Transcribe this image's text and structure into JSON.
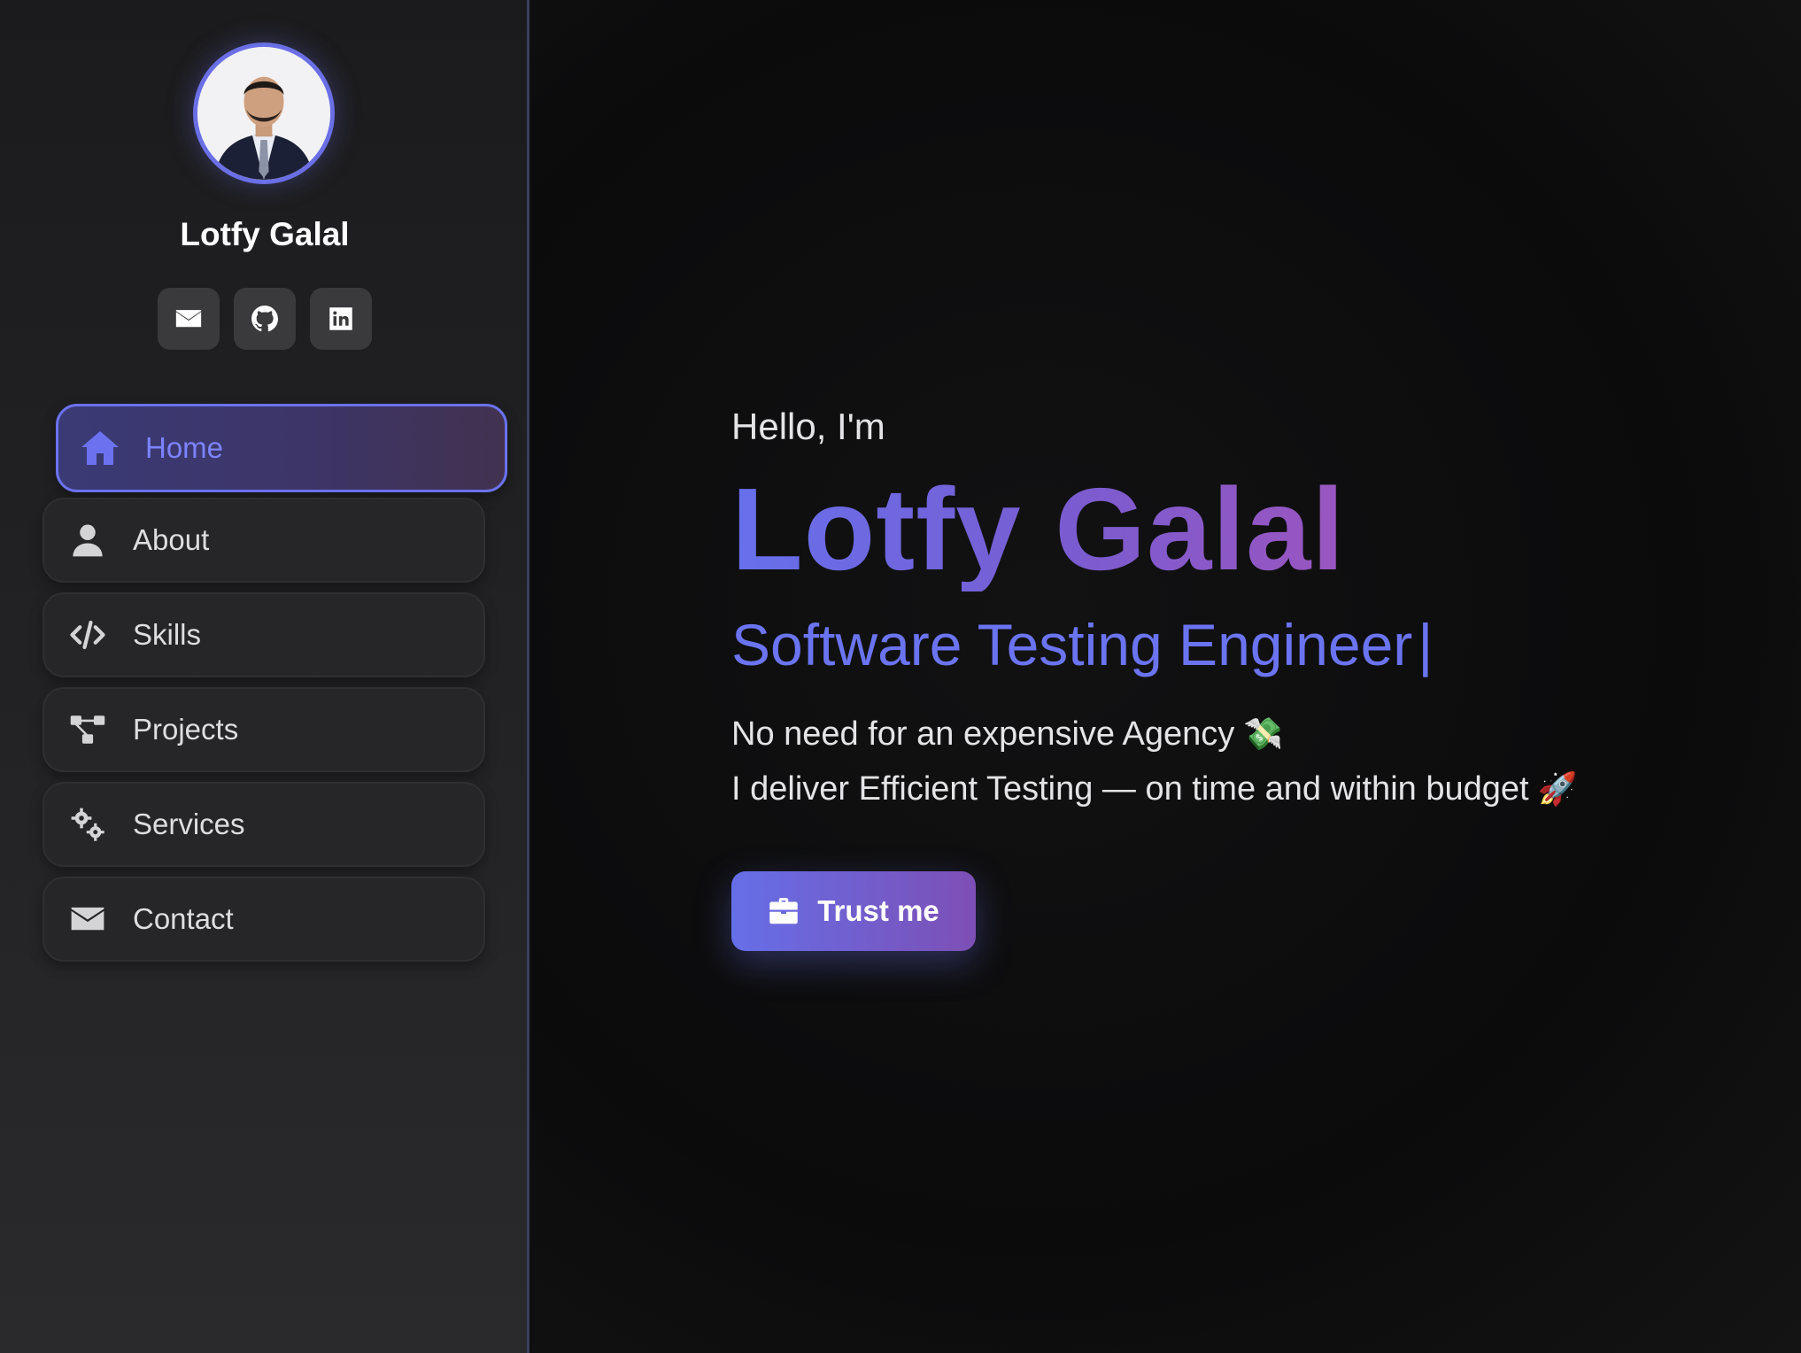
{
  "profile": {
    "name": "Lotfy Galal"
  },
  "socials": [
    {
      "icon": "envelope-icon"
    },
    {
      "icon": "github-icon"
    },
    {
      "icon": "linkedin-icon"
    }
  ],
  "nav": {
    "items": [
      {
        "label": "Home",
        "icon": "home-icon",
        "active": true
      },
      {
        "label": "About",
        "icon": "user-icon"
      },
      {
        "label": "Skills",
        "icon": "code-icon"
      },
      {
        "label": "Projects",
        "icon": "project-diagram-icon"
      },
      {
        "label": "Services",
        "icon": "gears-icon"
      },
      {
        "label": "Contact",
        "icon": "envelope-icon"
      }
    ]
  },
  "hero": {
    "greeting": "Hello, I'm",
    "name": "Lotfy Galal",
    "role": "Software Testing Engineer",
    "cursor": "|",
    "line1": "No need for an expensive Agency",
    "line1_emoji": "💸",
    "line2": "I deliver Efficient Testing — on time and within budget",
    "line2_emoji": "🚀",
    "cta_label": "Trust me"
  },
  "colors": {
    "accent": "#6b72f0",
    "accent_purple": "#9a55bf",
    "sidebar_bg": "#232325",
    "main_bg": "#0e0e0f"
  }
}
